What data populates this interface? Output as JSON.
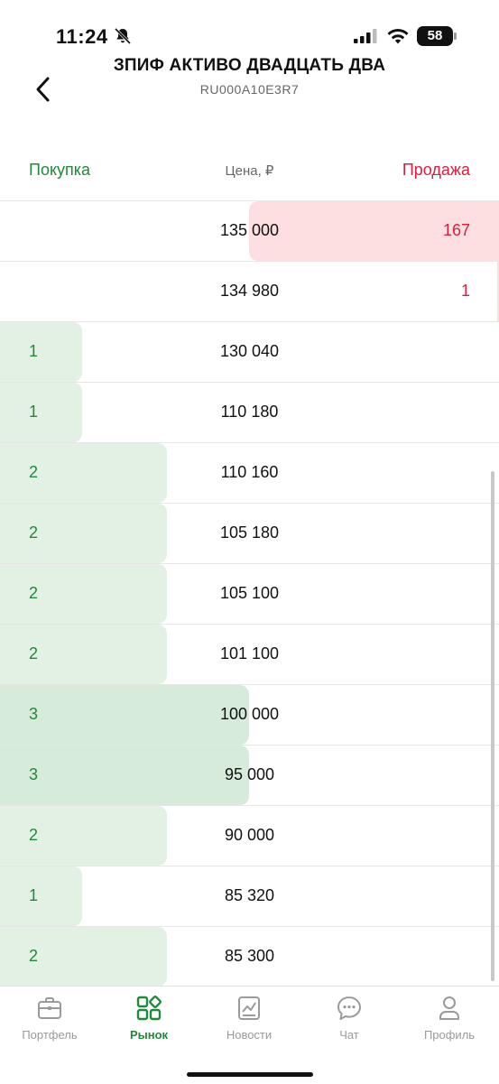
{
  "status_bar": {
    "time": "11:24",
    "battery": "58"
  },
  "header": {
    "title": "ЗПИФ АКТИВО ДВАДЦАТЬ ДВА",
    "subtitle": "RU000A10E3R7"
  },
  "columns": {
    "buy": "Покупка",
    "price": "Цена, ₽",
    "sell": "Продажа"
  },
  "order_book": [
    {
      "price": "135 000",
      "buy": "",
      "sell": "167",
      "sell_fill": 0.5,
      "buy_fill": 0
    },
    {
      "price": "134 980",
      "buy": "",
      "sell": "1",
      "sell_fill": 0,
      "buy_fill": 0
    },
    {
      "price": "130 040",
      "buy": "1",
      "sell": "",
      "buy_fill": 0.33
    },
    {
      "price": "110 180",
      "buy": "1",
      "sell": "",
      "buy_fill": 0.33
    },
    {
      "price": "110 160",
      "buy": "2",
      "sell": "",
      "buy_fill": 0.67
    },
    {
      "price": "105 180",
      "buy": "2",
      "sell": "",
      "buy_fill": 0.67
    },
    {
      "price": "105 100",
      "buy": "2",
      "sell": "",
      "buy_fill": 0.67
    },
    {
      "price": "101 100",
      "buy": "2",
      "sell": "",
      "buy_fill": 0.67
    },
    {
      "price": "100 000",
      "buy": "3",
      "sell": "",
      "buy_fill": 1.0
    },
    {
      "price": "95 000",
      "buy": "3",
      "sell": "",
      "buy_fill": 1.0
    },
    {
      "price": "90 000",
      "buy": "2",
      "sell": "",
      "buy_fill": 0.67
    },
    {
      "price": "85 320",
      "buy": "1",
      "sell": "",
      "buy_fill": 0.33
    },
    {
      "price": "85 300",
      "buy": "2",
      "sell": "",
      "buy_fill": 0.67
    }
  ],
  "tabs": [
    {
      "label": "Портфель",
      "icon": "briefcase-icon",
      "active": false
    },
    {
      "label": "Рынок",
      "icon": "market-grid-icon",
      "active": true
    },
    {
      "label": "Новости",
      "icon": "news-chart-icon",
      "active": false
    },
    {
      "label": "Чат",
      "icon": "chat-bubble-icon",
      "active": false
    },
    {
      "label": "Профиль",
      "icon": "profile-icon",
      "active": false
    }
  ],
  "colors": {
    "buy": "#1f8a3a",
    "sell": "#dc1e3c",
    "buy_bar": "#e3f1e5",
    "sell_bar": "#fddfe2"
  }
}
